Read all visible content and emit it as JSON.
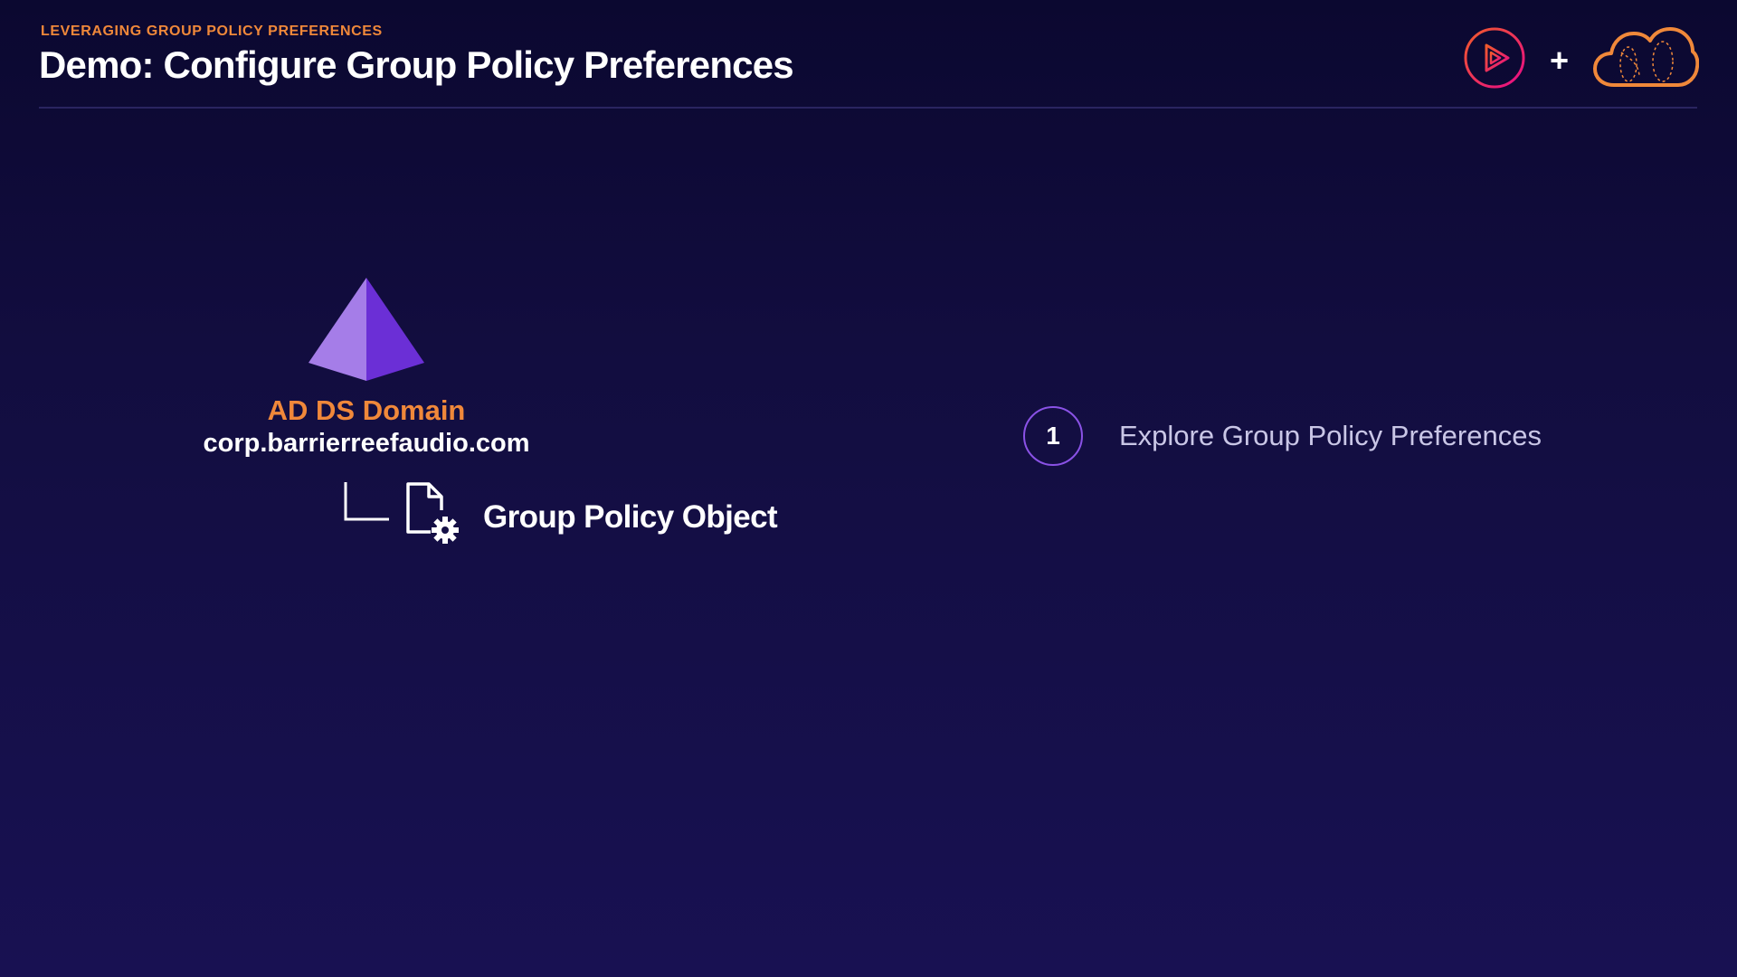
{
  "header": {
    "eyebrow": "LEVERAGING GROUP POLICY PREFERENCES",
    "title": "Demo: Configure Group Policy Preferences"
  },
  "branding": {
    "logos": [
      "pluralsight-play-icon",
      "cloud-icon"
    ],
    "separator": "+"
  },
  "diagram": {
    "domain": {
      "icon": "pyramid-icon",
      "label": "AD DS Domain",
      "name": "corp.barrierreefaudio.com"
    },
    "child": {
      "connector_icon": "tree-connector-icon",
      "icon": "document-gear-icon",
      "label": "Group Policy Object"
    }
  },
  "steps": [
    {
      "number": "1",
      "label": "Explore Group Policy Preferences"
    }
  ],
  "colors": {
    "accent_orange": "#f0883a",
    "accent_purple": "#8a52e6",
    "brand_red": "#e8335a",
    "background": "#120d3f"
  }
}
